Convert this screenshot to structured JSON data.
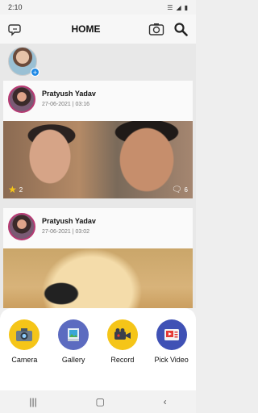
{
  "status": {
    "time": "2:10",
    "icons": [
      "wifi-icon",
      "signal-icon",
      "battery-icon"
    ]
  },
  "header": {
    "title": "HOME",
    "icons": [
      "chat-edit-icon",
      "camera-icon",
      "search-icon"
    ]
  },
  "posts": [
    {
      "author": "Pratyush Yadav",
      "date": "27-06-2021 | 03:16",
      "likes": "2",
      "comments": "6"
    },
    {
      "author": "Pratyush Yadav",
      "date": "27-06-2021 | 03:02"
    }
  ],
  "sheet": {
    "options": [
      {
        "label": "Camera",
        "icon": "camera-option-icon",
        "color": "#f5c518"
      },
      {
        "label": "Gallery",
        "icon": "gallery-option-icon",
        "color": "#5c6bc0"
      },
      {
        "label": "Record",
        "icon": "record-option-icon",
        "color": "#f5c518"
      },
      {
        "label": "Pick Video",
        "icon": "pick-video-option-icon",
        "color": "#3f51b5"
      }
    ]
  },
  "nav": {
    "icons": [
      "recents-icon",
      "home-icon",
      "back-icon"
    ]
  },
  "colors": {
    "accent": "#1e88e5",
    "ring": "#b73a73"
  }
}
